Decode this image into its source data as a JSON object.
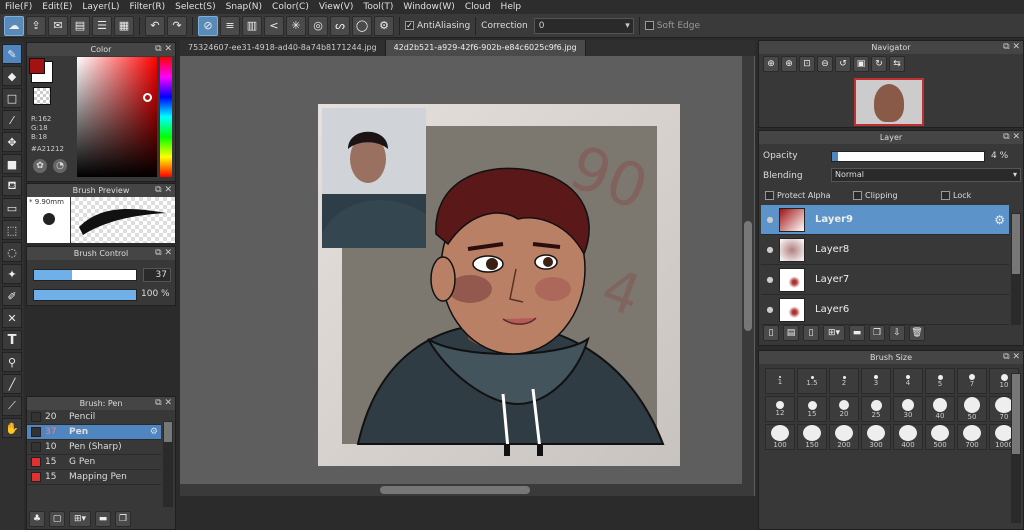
{
  "menu": [
    "File(F)",
    "Edit(E)",
    "Layer(L)",
    "Filter(R)",
    "Select(S)",
    "Snap(N)",
    "Color(C)",
    "View(V)",
    "Tool(T)",
    "Window(W)",
    "Cloud",
    "Help"
  ],
  "toolbar": {
    "antialiasing_label": "AntiAliasing",
    "correction_label": "Correction",
    "correction_value": "0",
    "soft_edge_label": "Soft Edge"
  },
  "color_panel": {
    "title": "Color",
    "r": "R:162",
    "g": "G:18",
    "b": "B:18",
    "hex": "#A21212",
    "main_color": "#a21212"
  },
  "brush_preview": {
    "title": "Brush Preview",
    "size": "* 9.90mm"
  },
  "brush_control": {
    "title": "Brush Control",
    "size_value": "37",
    "opacity_value": "100 %",
    "size_fill": 0.37,
    "opacity_fill": 1.0
  },
  "brush_list": {
    "title": "Brush: Pen",
    "items": [
      {
        "size": "20",
        "name": "Pencil",
        "color": "#333333"
      },
      {
        "size": "37",
        "name": "Pen",
        "color": "#333333",
        "selected": true
      },
      {
        "size": "10",
        "name": "Pen (Sharp)",
        "color": "#333333"
      },
      {
        "size": "15",
        "name": "G Pen",
        "color": "#e03030"
      },
      {
        "size": "15",
        "name": "Mapping Pen",
        "color": "#e03030"
      }
    ]
  },
  "tabs": [
    "75324607-ee31-4918-ad40-8a74b8171244.jpg",
    "42d2b521-a929-42f6-902b-e84c6025c9f6.jpg"
  ],
  "navigator": {
    "title": "Navigator"
  },
  "layer_panel": {
    "title": "Layer",
    "opacity_label": "Opacity",
    "opacity_value": "4 %",
    "opacity_fill": 0.04,
    "blending_label": "Blending",
    "blending_value": "Normal",
    "protect_alpha": "Protect Alpha",
    "clipping": "Clipping",
    "lock": "Lock",
    "layers": [
      {
        "name": "Layer9",
        "selected": true
      },
      {
        "name": "Layer8"
      },
      {
        "name": "Layer7"
      },
      {
        "name": "Layer6"
      }
    ]
  },
  "brush_size": {
    "title": "Brush Size",
    "sizes": [
      "1",
      "1.5",
      "2",
      "3",
      "4",
      "5",
      "7",
      "10",
      "12",
      "15",
      "20",
      "25",
      "30",
      "40",
      "50",
      "70",
      "100",
      "150",
      "200",
      "300",
      "400",
      "500",
      "700",
      "1000"
    ]
  }
}
